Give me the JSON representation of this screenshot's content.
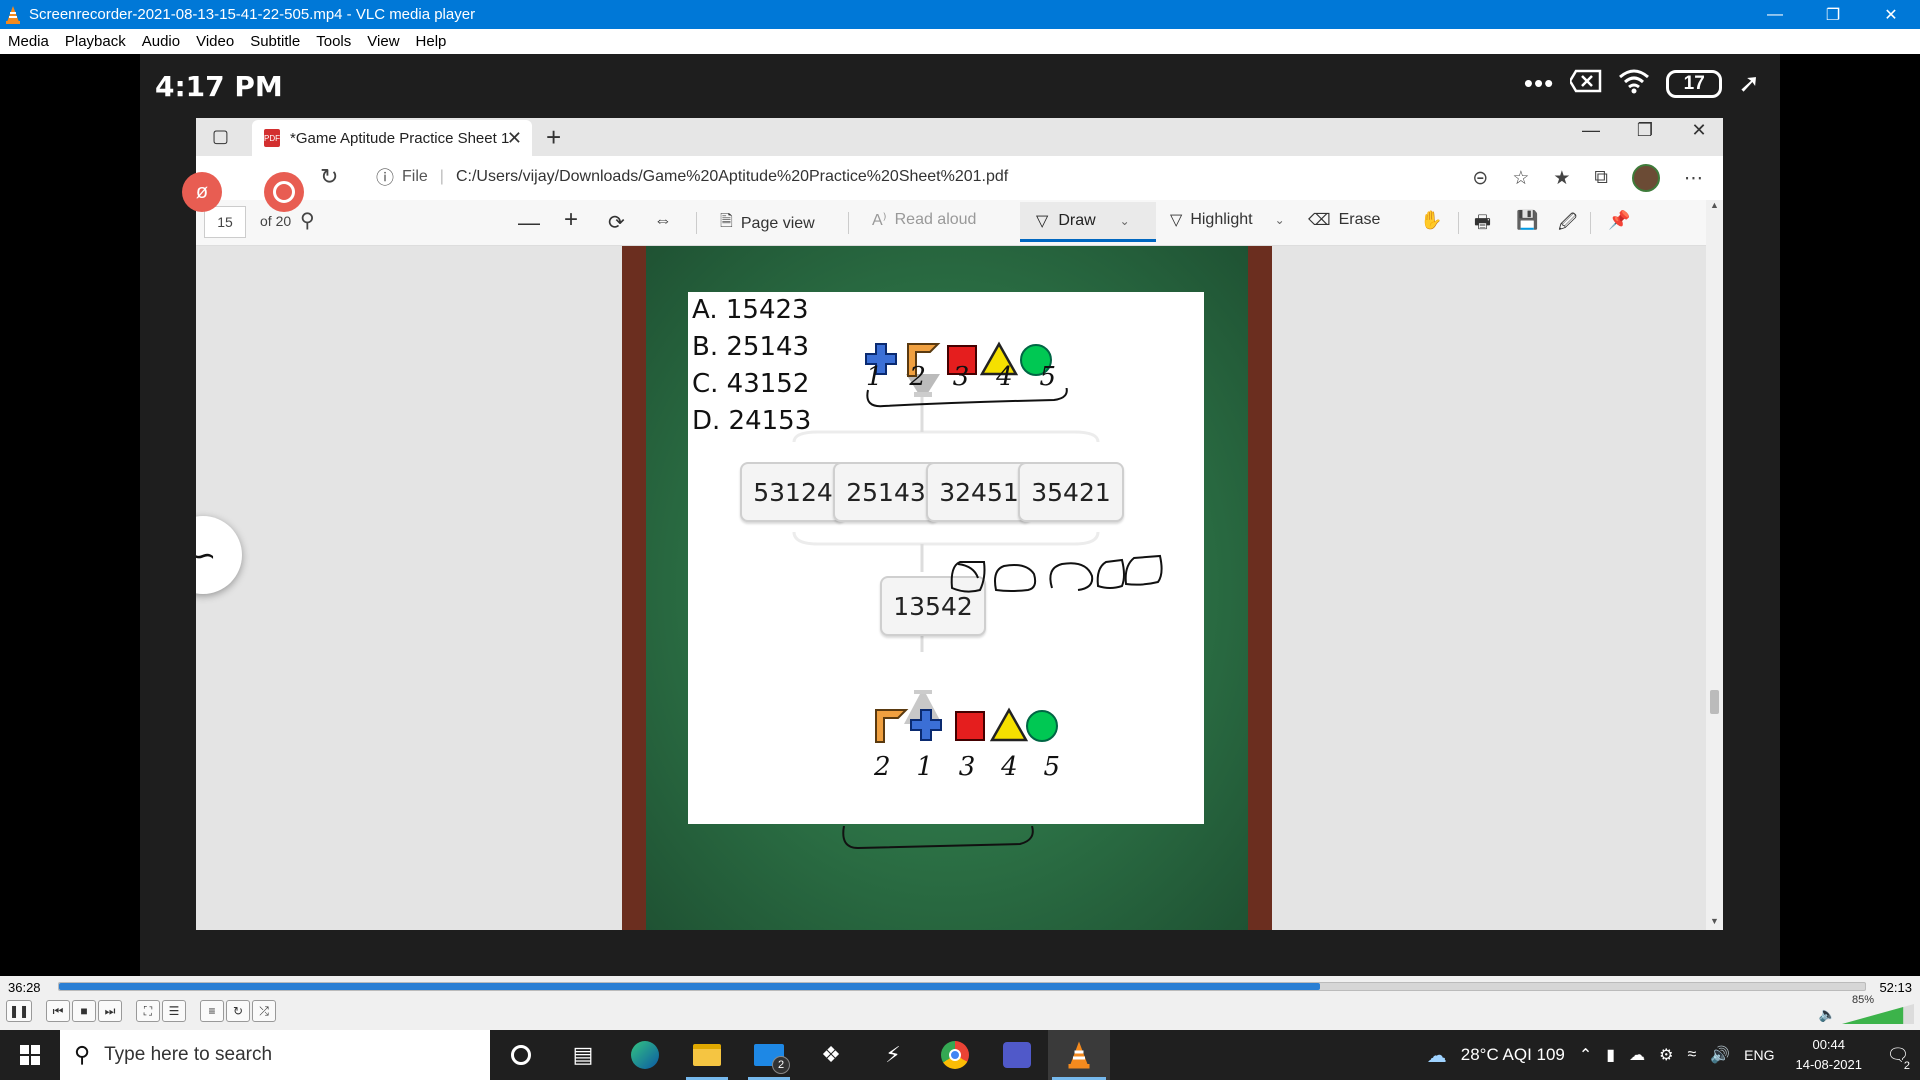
{
  "vlc": {
    "window_title": "Screenrecorder-2021-08-13-15-41-22-505.mp4 - VLC media player",
    "menu": [
      "Media",
      "Playback",
      "Audio",
      "Video",
      "Subtitle",
      "Tools",
      "View",
      "Help"
    ],
    "time_elapsed": "36:28",
    "time_total": "52:13",
    "progress": 0.698,
    "volume_label": "85%",
    "volume": 0.85
  },
  "phone": {
    "time": "4:17 PM",
    "battery": "17"
  },
  "edge": {
    "tab_title": "*Game Aptitude Practice Sheet 1",
    "tab_icon_text": "PDF",
    "address_prefix": "File",
    "address": "C:/Users/vijay/Downloads/Game%20Aptitude%20Practice%20Sheet%201.pdf",
    "pdf_toolbar": {
      "page": "15",
      "of_pages": "of 20",
      "page_view": "Page view",
      "read_aloud": "Read aloud",
      "draw": "Draw",
      "highlight": "Highlight",
      "erase": "Erase"
    }
  },
  "pdf": {
    "options": [
      "A. 15423",
      "B. 25143",
      "C. 43152",
      "D. 24153"
    ],
    "boxes": [
      "53124",
      "25143",
      "32451",
      "35421"
    ],
    "result_box": "13542",
    "handwritten_top": [
      "1",
      "2",
      "3",
      "4",
      "5"
    ],
    "handwritten_bottom": [
      "2",
      "1",
      "3",
      "4",
      "5"
    ]
  },
  "taskbar": {
    "search_placeholder": "Type here to search",
    "weather": "28°C AQI 109",
    "language": "ENG",
    "time": "00:44",
    "date": "14-08-2021",
    "mail_badge": "2",
    "notifications_count": "2"
  },
  "colors": {
    "vlc_blue": "#0078d7",
    "seek_fill": "#2a7fd4",
    "board_green": "#2b6f44",
    "red_shape": "#e51e1e",
    "yellow_shape": "#f5e000",
    "green_shape": "#00c853",
    "blue_plus": "#3b6fd6",
    "orange_flag": "#f0a040"
  }
}
